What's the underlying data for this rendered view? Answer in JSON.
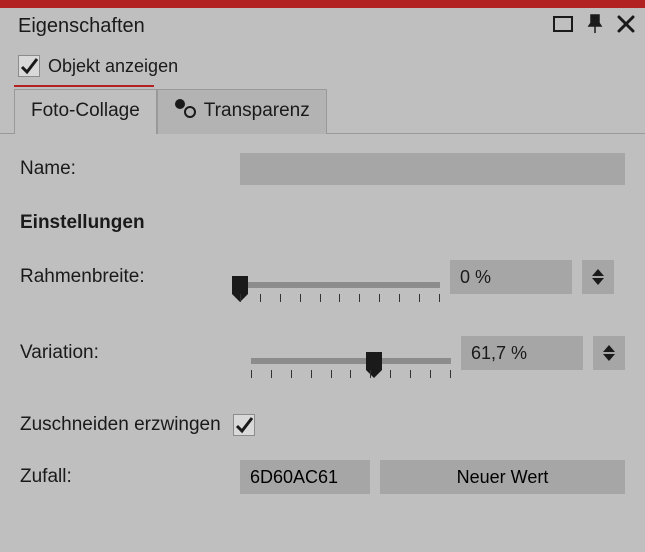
{
  "panel": {
    "title": "Eigenschaften",
    "show_object_label": "Objekt anzeigen"
  },
  "tabs": {
    "foto_collage": "Foto-Collage",
    "transparenz": "Transparenz"
  },
  "fields": {
    "name_label": "Name:",
    "name_value": "",
    "settings_heading": "Einstellungen",
    "frame_width_label": "Rahmenbreite:",
    "frame_width_value": "0 %",
    "frame_width_pct": 0,
    "variation_label": "Variation:",
    "variation_value": "61,7 %",
    "variation_pct": 61.7,
    "force_crop_label": "Zuschneiden erzwingen",
    "random_label": "Zufall:",
    "random_value": "6D60AC61",
    "new_value_button": "Neuer Wert"
  }
}
